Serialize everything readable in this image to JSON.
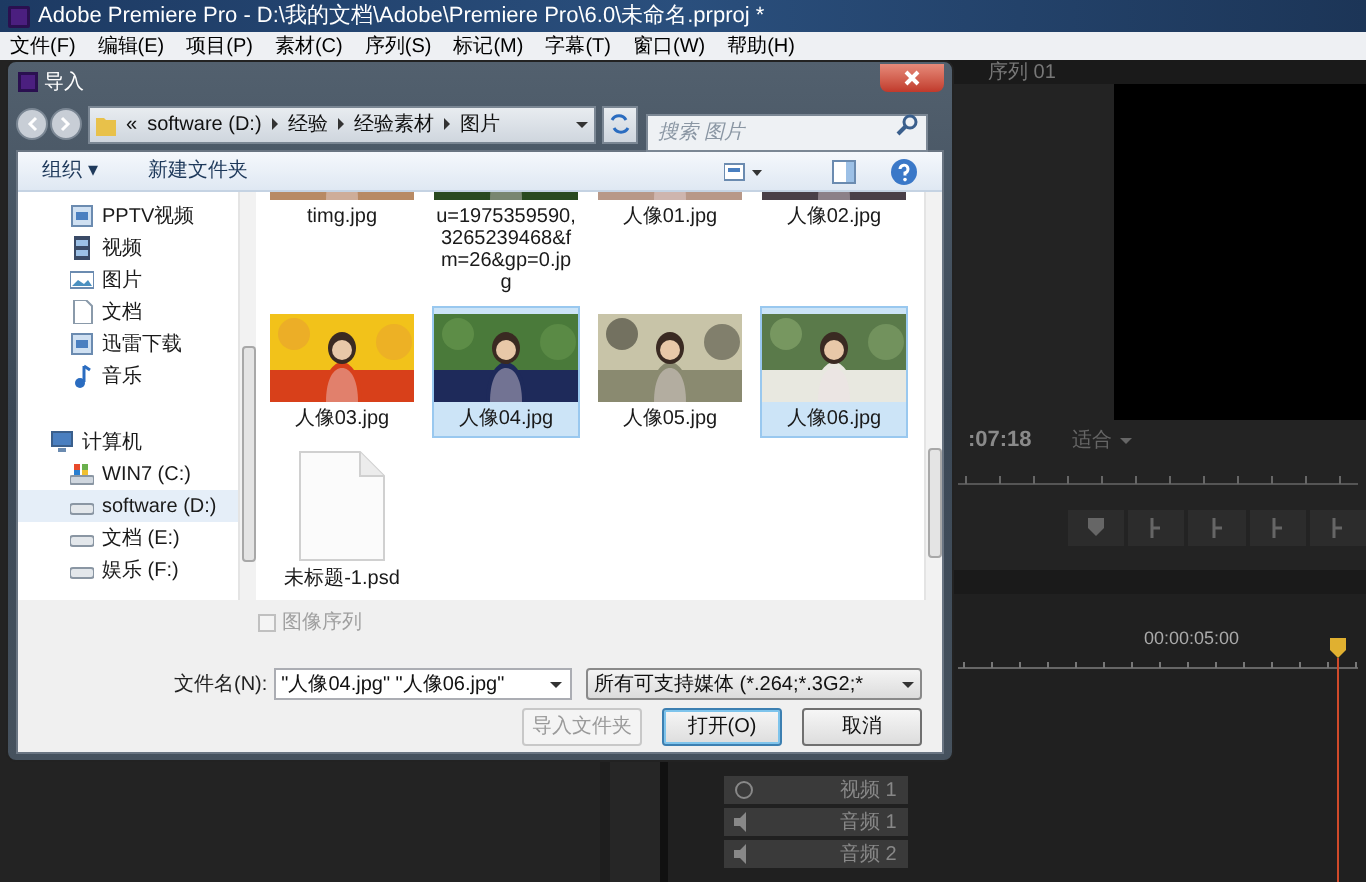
{
  "app": {
    "title": "Adobe Premiere Pro - D:\\我的文档\\Adobe\\Premiere Pro\\6.0\\未命名.prproj *",
    "menu": [
      "文件(F)",
      "编辑(E)",
      "项目(P)",
      "素材(C)",
      "序列(S)",
      "标记(M)",
      "字幕(T)",
      "窗口(W)",
      "帮助(H)"
    ]
  },
  "dialog": {
    "title": "导入",
    "breadcrumb": [
      "«",
      "software (D:)",
      "经验",
      "经验素材",
      "图片"
    ],
    "search": {
      "placeholder": "搜索 图片"
    },
    "toolbar": {
      "organize": "组织 ▾",
      "new_folder": "新建文件夹"
    },
    "nav": [
      {
        "label": "PPTV视频",
        "kind": "library",
        "selected": false
      },
      {
        "label": "视频",
        "kind": "video",
        "selected": false
      },
      {
        "label": "图片",
        "kind": "pictures",
        "selected": false
      },
      {
        "label": "文档",
        "kind": "documents",
        "selected": false
      },
      {
        "label": "迅雷下载",
        "kind": "library",
        "selected": false
      },
      {
        "label": "音乐",
        "kind": "music",
        "selected": false
      },
      {
        "label": "计算机",
        "kind": "computer",
        "selected": false,
        "children": [
          {
            "label": "WIN7 (C:)",
            "kind": "system-drive",
            "selected": false
          },
          {
            "label": "software (D:)",
            "kind": "drive",
            "selected": true
          },
          {
            "label": "文档 (E:)",
            "kind": "drive",
            "selected": false
          },
          {
            "label": "娱乐 (F:)",
            "kind": "drive",
            "selected": false
          }
        ]
      }
    ],
    "file_rows": [
      [
        {
          "name": "timg.jpg",
          "kind": "picture",
          "selected": false
        },
        {
          "name": "u=1975359590,3265239468&fm=26&gp=0.jpg",
          "kind": "picture",
          "selected": false
        },
        {
          "name": "人像01.jpg",
          "kind": "picture",
          "selected": false
        },
        {
          "name": "人像02.jpg",
          "kind": "picture",
          "selected": false
        }
      ],
      [
        {
          "name": "人像03.jpg",
          "kind": "picture",
          "selected": false
        },
        {
          "name": "人像04.jpg",
          "kind": "picture",
          "selected": true
        },
        {
          "name": "人像05.jpg",
          "kind": "picture",
          "selected": false
        },
        {
          "name": "人像06.jpg",
          "kind": "picture",
          "selected": true
        }
      ],
      [
        {
          "name": "未标题-1.psd",
          "kind": "document",
          "selected": false
        }
      ]
    ],
    "sequence_option": {
      "label": "图像序列",
      "checked": false,
      "disabled": true
    },
    "file_name": {
      "label": "文件名(N):",
      "value": "\"人像04.jpg\" \"人像06.jpg\""
    },
    "file_type": "所有可支持媒体 (*.264;*.3G2;*",
    "buttons": [
      {
        "label": "导入文件夹",
        "disabled": true,
        "default": false
      },
      {
        "label": "打开(O)",
        "disabled": false,
        "default": true
      },
      {
        "label": "取消",
        "disabled": false,
        "default": false
      }
    ]
  },
  "monitor": {
    "tab": "序列 01",
    "time": ":07:18",
    "zoom": "适合"
  },
  "timeline": {
    "timecode": "00:00:05:00",
    "tracks": [
      {
        "name": "视频 1",
        "kind": "video"
      },
      {
        "name": "音频 1",
        "kind": "audio"
      },
      {
        "name": "音频 2",
        "kind": "audio"
      }
    ]
  }
}
